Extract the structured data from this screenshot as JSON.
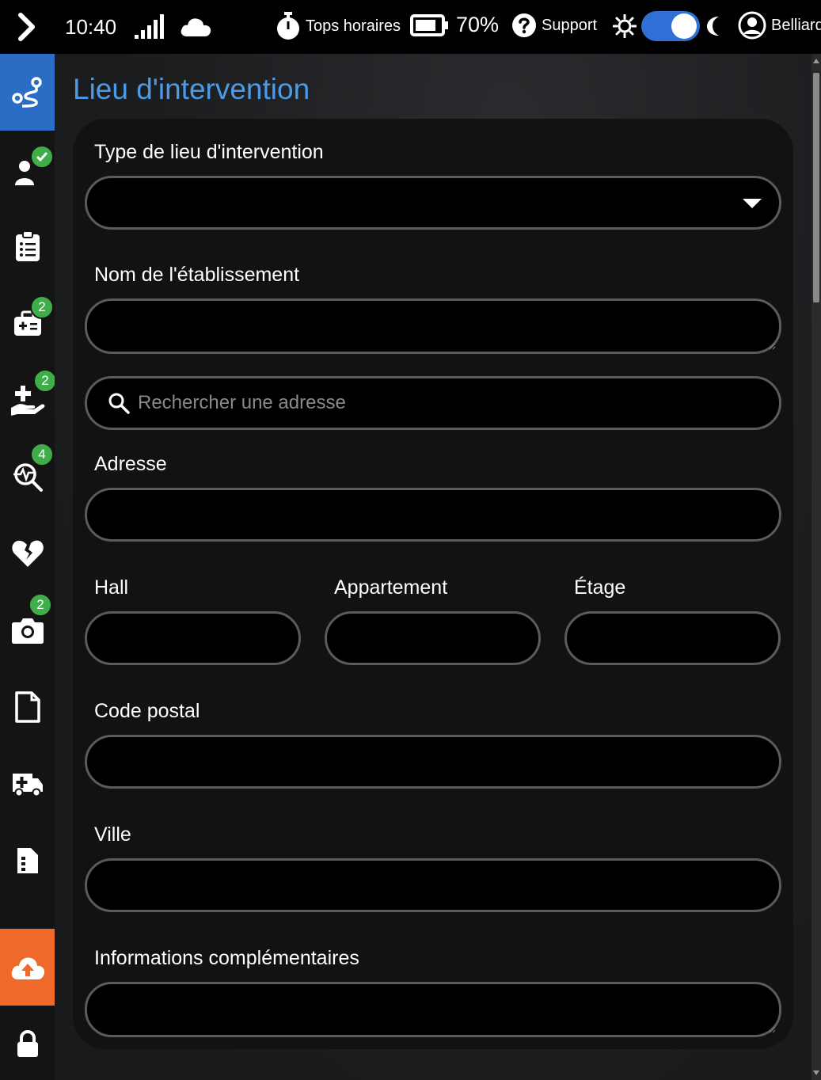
{
  "topbar": {
    "time": "10:40",
    "tops_label": "Tops horaires",
    "battery_pct": "70%",
    "support_label": "Support",
    "user_label": "Belliard",
    "dark_mode": true
  },
  "sidebar": {
    "items": [
      {
        "name": "route",
        "badge": ""
      },
      {
        "name": "patient-check",
        "badge": ""
      },
      {
        "name": "clipboard-list",
        "badge": ""
      },
      {
        "name": "medical-kit",
        "badge": "2"
      },
      {
        "name": "care-hand",
        "badge": "2"
      },
      {
        "name": "vitals-search",
        "badge": "4"
      },
      {
        "name": "broken-heart",
        "badge": ""
      },
      {
        "name": "camera",
        "badge": "2"
      },
      {
        "name": "document",
        "badge": ""
      },
      {
        "name": "ambulance",
        "badge": ""
      },
      {
        "name": "file-form",
        "badge": ""
      },
      {
        "name": "cloud-upload",
        "badge": ""
      },
      {
        "name": "lock",
        "badge": ""
      }
    ]
  },
  "page": {
    "title": "Lieu d'intervention"
  },
  "form": {
    "type_label": "Type de lieu d'intervention",
    "type_value": "",
    "nom_label": "Nom de l'établissement",
    "nom_value": "",
    "search_placeholder": "Rechercher une adresse",
    "adresse_label": "Adresse",
    "hall_label": "Hall",
    "appartement_label": "Appartement",
    "etage_label": "Étage",
    "code_postal_label": "Code postal",
    "ville_label": "Ville",
    "infos_label": "Informations complémentaires"
  },
  "colors": {
    "accent": "#4d9be8",
    "active_nav": "#2b6cc4",
    "upload_nav": "#ef6a2a",
    "badge": "#3fae49",
    "toggle": "#2f6fd6"
  }
}
